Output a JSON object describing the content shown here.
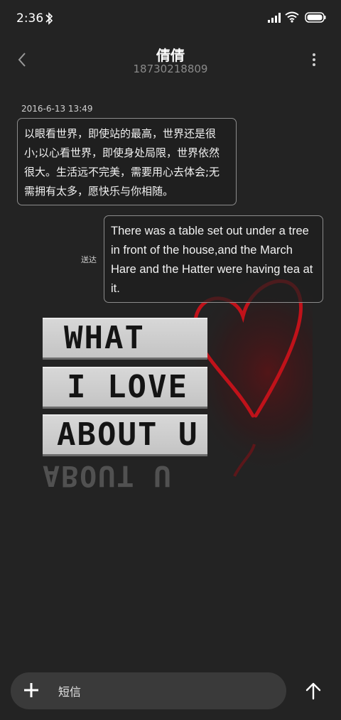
{
  "status_bar": {
    "time": "2:36"
  },
  "header": {
    "contact_name": "倩倩",
    "contact_number": "18730218809"
  },
  "conversation": {
    "timestamp": "2016-6-13 13:49",
    "incoming_message": "以眼看世界，即使站的最高，世界还是很小;以心看世界，即使身处局限，世界依然很大。生活远不完美，需要用心去体会;无需拥有太多，愿快乐与你相随。",
    "outgoing_message": "There was a table set out under a tree in front of the house,and the March Hare and the Hatter were having tea at it.",
    "delivery_status": "送达"
  },
  "background_image": {
    "lightbox_lines": [
      "WHAT",
      "I LOVE",
      "ABOUT U"
    ],
    "reflection_text": "ABOUT U",
    "heart_color": "#c0121a"
  },
  "composer": {
    "placeholder": "短信"
  }
}
